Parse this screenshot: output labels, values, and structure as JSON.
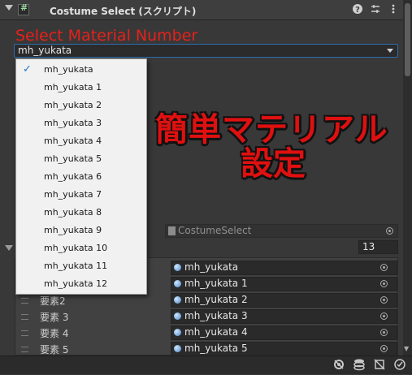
{
  "header": {
    "title": "Costume Select (スクリプト)",
    "script_glyph": "#",
    "help_glyph": "?",
    "preset_glyph": "⇆",
    "menu_glyph": "⋮"
  },
  "field": {
    "label": "Select Material Number",
    "value": "mh_yukata"
  },
  "dropdown": {
    "checked_index": 0,
    "options": [
      "mh_yukata",
      "mh_yukata 1",
      "mh_yukata 2",
      "mh_yukata 3",
      "mh_yukata 4",
      "mh_yukata 5",
      "mh_yukata 6",
      "mh_yukata 7",
      "mh_yukata 8",
      "mh_yukata 9",
      "mh_yukata 10",
      "mh_yukata 11",
      "mh_yukata 12"
    ]
  },
  "banner": {
    "line1": "簡単マテリアル",
    "line2": "設定"
  },
  "script_field": {
    "value": "CostumeSelect"
  },
  "list": {
    "size": "13",
    "elements": [
      {
        "label": "",
        "value": "mh_yukata"
      },
      {
        "label": "",
        "value": "mh_yukata 1"
      },
      {
        "label": "要素2",
        "value": "mh_yukata 2"
      },
      {
        "label": "要素 3",
        "value": "mh_yukata 3"
      },
      {
        "label": "要素 4",
        "value": "mh_yukata 4"
      },
      {
        "label": "要素 5",
        "value": "mh_yukata 5"
      }
    ]
  },
  "colors": {
    "accent_red": "#e8201a",
    "focus_blue": "#2f6dad",
    "check_blue": "#1e74c9"
  },
  "icons": [
    "settings-icon",
    "layers-icon",
    "debug-icon",
    "console-icon"
  ]
}
